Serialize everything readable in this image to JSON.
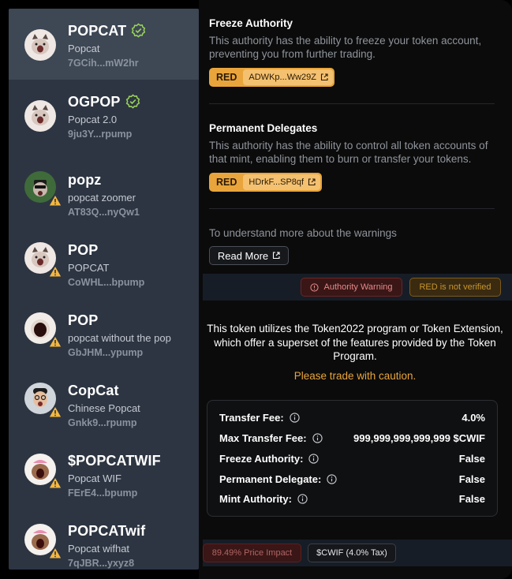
{
  "tokens": [
    {
      "name": "POPCAT",
      "subtitle": "Popcat",
      "address": "7GCih...mW2hr",
      "verified": true,
      "warning": false,
      "avatar": "popcat-avatar"
    },
    {
      "name": "OGPOP",
      "subtitle": "Popcat 2.0",
      "address": "9ju3Y...rpump",
      "verified": true,
      "warning": false,
      "avatar": "popcat-avatar"
    },
    {
      "name": "popz",
      "subtitle": "popcat zoomer",
      "address": "AT83Q...nyQw1",
      "verified": false,
      "warning": true,
      "avatar": "zoomer-avatar"
    },
    {
      "name": "POP",
      "subtitle": "POPCAT",
      "address": "CoWHL...bpump",
      "verified": false,
      "warning": true,
      "avatar": "popcat-avatar"
    },
    {
      "name": "POP",
      "subtitle": "popcat without the pop",
      "address": "GbJHM...ypump",
      "verified": false,
      "warning": true,
      "avatar": "popcat-mouth-avatar"
    },
    {
      "name": "CopCat",
      "subtitle": "Chinese Popcat",
      "address": "Gnkk9...rpump",
      "verified": false,
      "warning": true,
      "avatar": "person-avatar"
    },
    {
      "name": "$POPCATWIF",
      "subtitle": "Popcat WIF",
      "address": "FErE4...bpump",
      "verified": false,
      "warning": true,
      "avatar": "popcat-hat-avatar"
    },
    {
      "name": "POPCATwif",
      "subtitle": "Popcat wifhat",
      "address": "7qJBR...yxyz8",
      "verified": false,
      "warning": true,
      "avatar": "popcat-hat-avatar"
    }
  ],
  "freeze": {
    "title": "Freeze Authority",
    "description": "This authority has the ability to freeze your token account, preventing you from further trading.",
    "level": "RED",
    "address": "ADWKp...Ww29Z"
  },
  "delegate": {
    "title": "Permanent Delegates",
    "description": "This authority has the ability to control all token accounts of that mint, enabling them to burn or transfer your tokens.",
    "level": "RED",
    "address": "HDrkF...SP8qf"
  },
  "learn": {
    "text": "To understand more about the warnings",
    "button": "Read More"
  },
  "warnings": {
    "authority": "Authority Warning",
    "unverified": "RED is not verified"
  },
  "info": {
    "text": "This token utilizes the Token2022 program or Token Extension, which offer a superset of the features provided by the Token Program.",
    "caution": "Please trade with caution."
  },
  "fees": [
    {
      "label": "Transfer Fee:",
      "value": "4.0%"
    },
    {
      "label": "Max Transfer Fee:",
      "value": "999,999,999,999,999 $CWIF"
    },
    {
      "label": "Freeze Authority:",
      "value": "False"
    },
    {
      "label": "Permanent Delegate:",
      "value": "False"
    },
    {
      "label": "Mint Authority:",
      "value": "False"
    }
  ],
  "bottom": {
    "impact": "89.49% Price Impact",
    "tax": "$CWIF (4.0% Tax)"
  },
  "colors": {
    "sidebar": "#2d3542",
    "active": "#3e4754",
    "verified": "#9ad35a",
    "warning": "#f4b740",
    "red_pill": "#e9a53b",
    "caution": "#e9a53b"
  }
}
